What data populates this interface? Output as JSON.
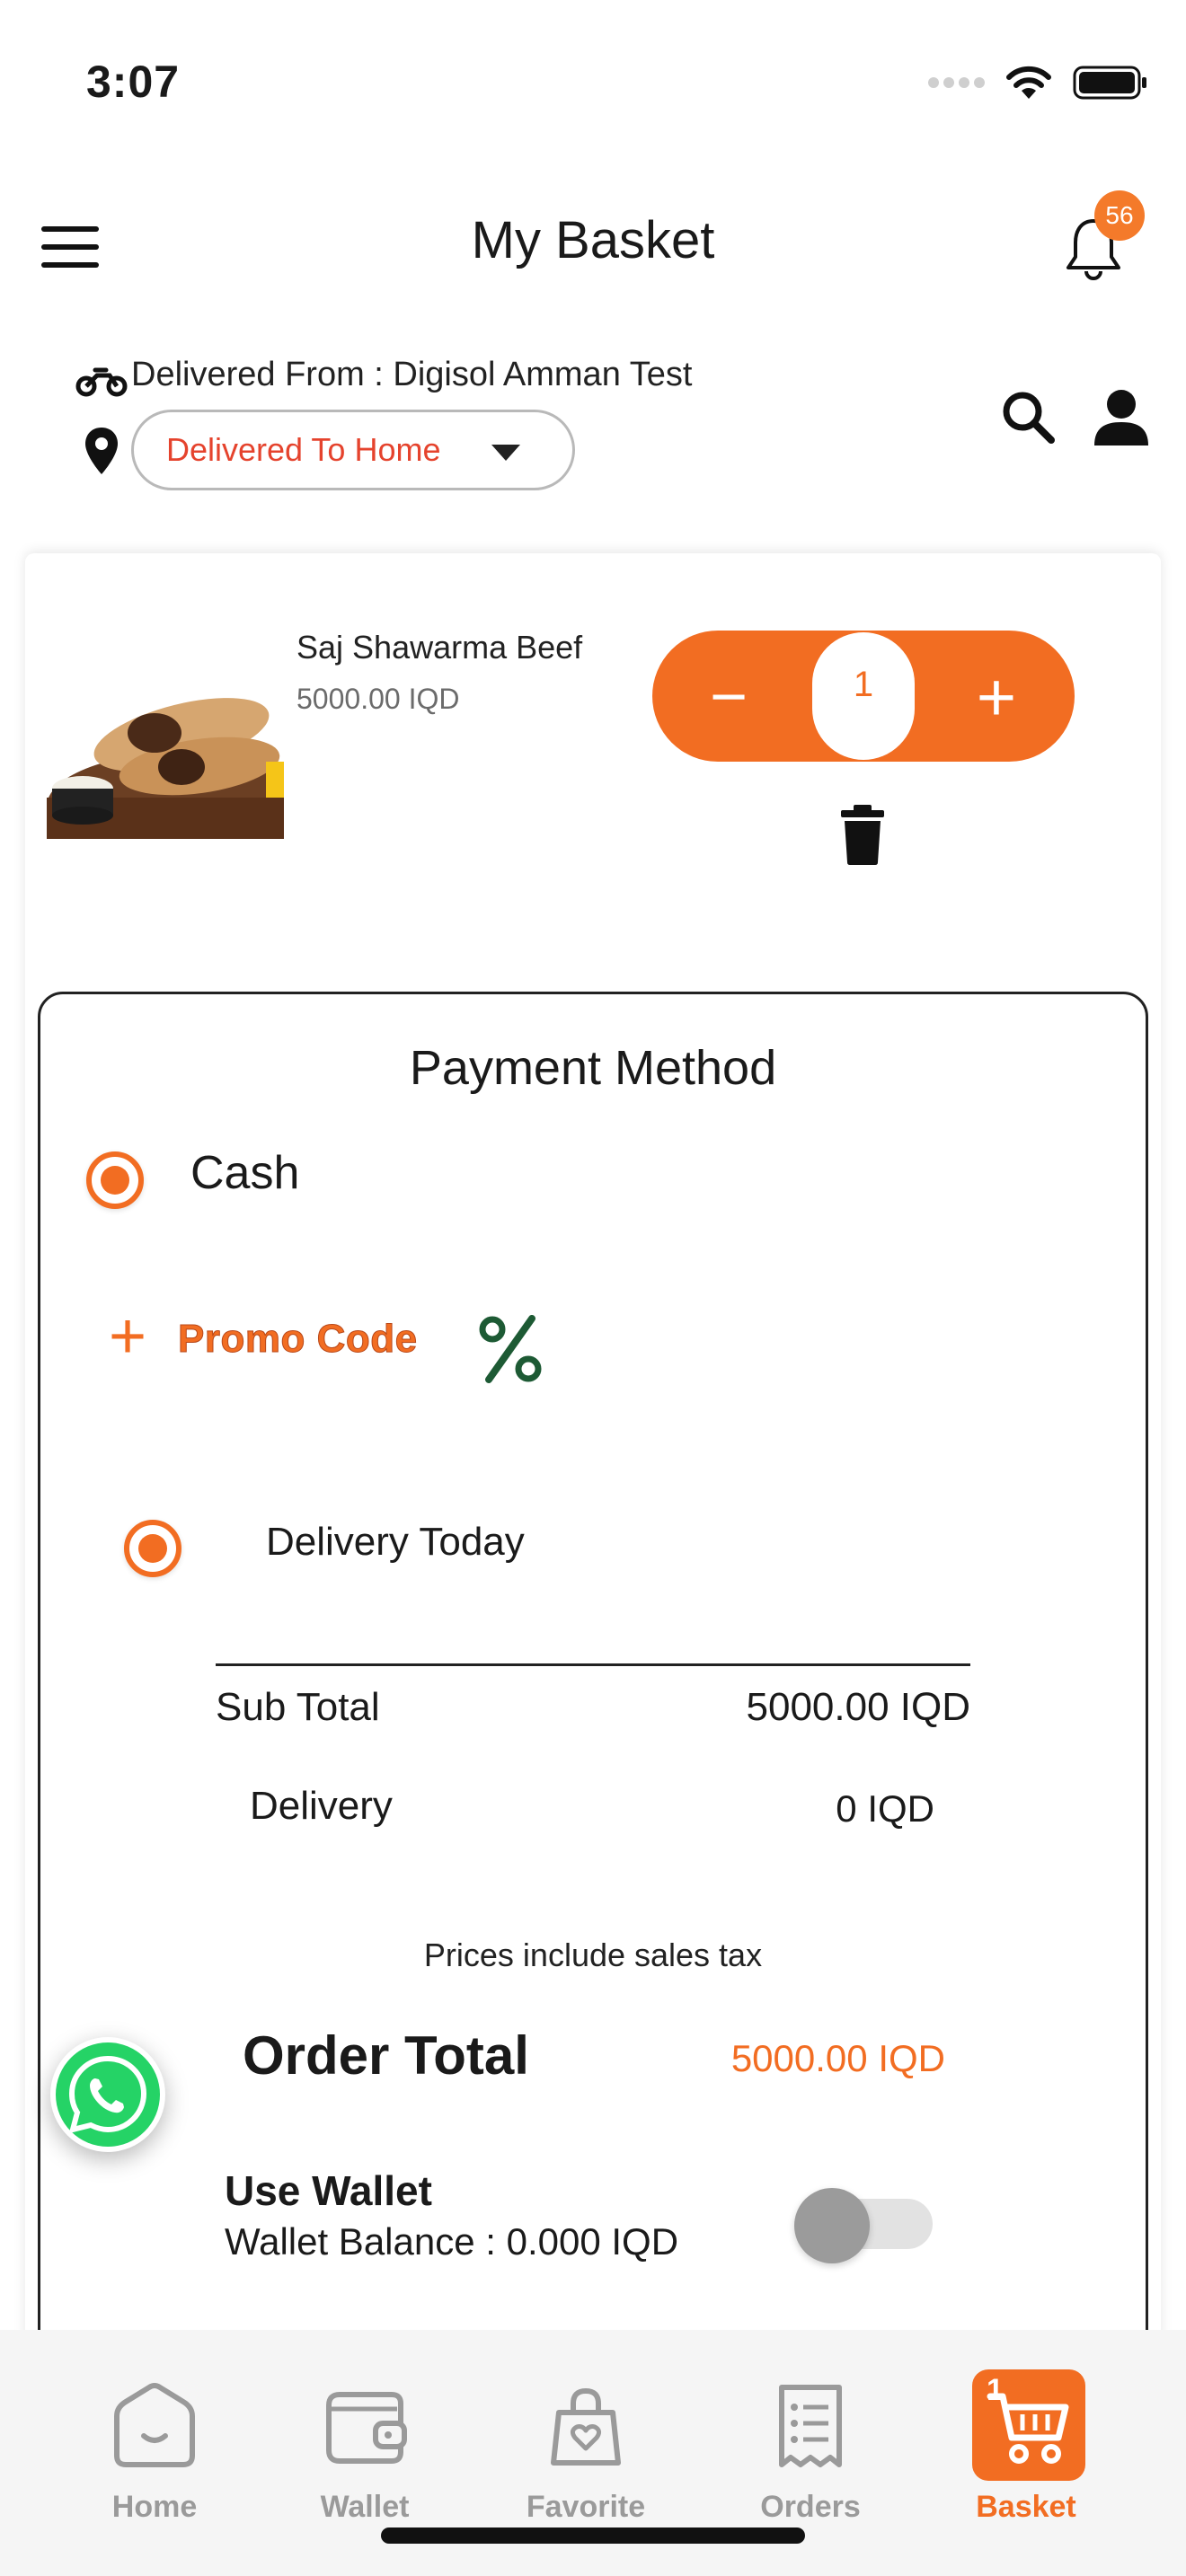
{
  "status_bar": {
    "time": "3:07"
  },
  "header": {
    "title": "My Basket",
    "notification_count": "56"
  },
  "delivery": {
    "from_text": "Delivered From : Digisol Amman Test",
    "mode_selected": "Delivered To Home"
  },
  "basket": {
    "items": [
      {
        "name": "Saj Shawarma Beef",
        "price": "5000.00 IQD",
        "quantity": "1"
      }
    ]
  },
  "payment": {
    "title": "Payment Method",
    "method_label": "Cash",
    "promo_label": "Promo Code",
    "delivery_option": "Delivery Today",
    "sub_total_label": "Sub Total",
    "sub_total_value": "5000.00 IQD",
    "delivery_label": "Delivery",
    "delivery_value": "0 IQD",
    "tax_note": "Prices include sales tax",
    "order_total_label": "Order Total",
    "order_total_value": "5000.00 IQD",
    "wallet_label": "Use Wallet",
    "wallet_balance": "Wallet Balance : 0.000 IQD",
    "wallet_enabled": false
  },
  "tabs": [
    {
      "label": "Home",
      "icon": "home-icon"
    },
    {
      "label": "Wallet",
      "icon": "wallet-icon"
    },
    {
      "label": "Favorite",
      "icon": "favorite-bag-icon"
    },
    {
      "label": "Orders",
      "icon": "orders-receipt-icon"
    },
    {
      "label": "Basket",
      "icon": "basket-cart-icon",
      "badge": "1",
      "active": true
    }
  ],
  "colors": {
    "accent": "#f26d22",
    "delivery_mode_text": "#e5432d",
    "tab_inactive": "#9a9a9a",
    "whatsapp": "#25d366"
  }
}
